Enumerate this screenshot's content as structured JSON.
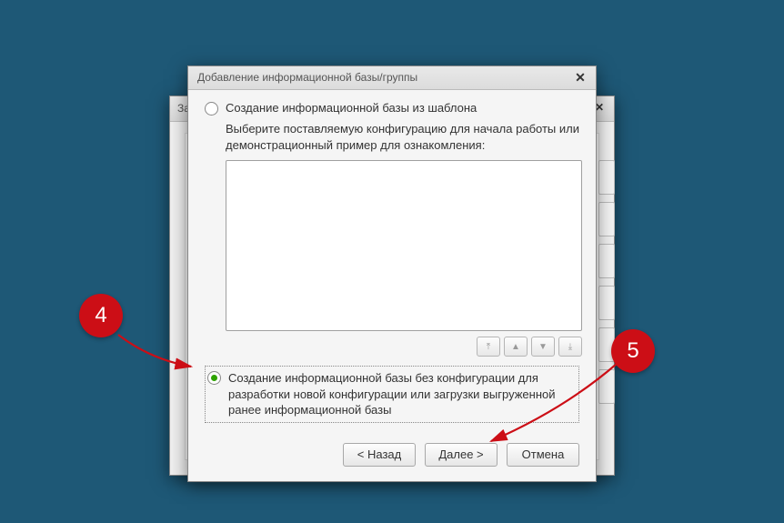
{
  "bg_window": {
    "title_fragment": "За",
    "close_label": "✕"
  },
  "dialog": {
    "title": "Добавление информационной базы/группы",
    "close_label": "✕",
    "option1": {
      "label": "Создание информационной базы из шаблона",
      "hint": "Выберите поставляемую конфигурацию для начала работы или демонстрационный пример для ознакомления:"
    },
    "arrows": {
      "top": "⤒",
      "up": "▲",
      "down": "▼",
      "bottom": "⤓"
    },
    "option2": {
      "label": "Создание информационной базы без конфигурации для разработки новой конфигурации или загрузки выгруженной ранее информационной базы"
    },
    "buttons": {
      "back": "< Назад",
      "next": "Далее >",
      "cancel": "Отмена"
    }
  },
  "callouts": {
    "c4": "4",
    "c5": "5"
  }
}
